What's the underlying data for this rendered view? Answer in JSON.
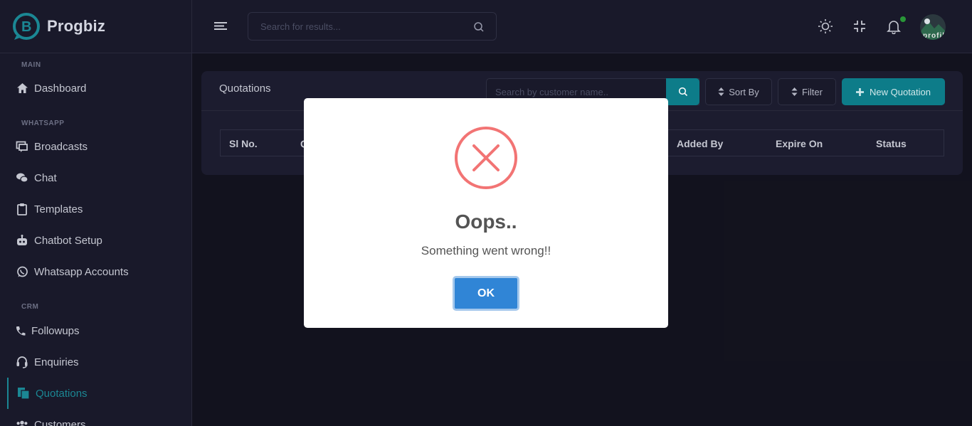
{
  "app": {
    "name": "Progbiz"
  },
  "sidebar": {
    "sections": [
      {
        "label": "MAIN"
      },
      {
        "label": "WHATSAPP"
      },
      {
        "label": "CRM"
      }
    ],
    "items": [
      {
        "label": "Dashboard",
        "icon": "home-icon"
      },
      {
        "label": "Broadcasts",
        "icon": "broadcast-icon"
      },
      {
        "label": "Chat",
        "icon": "chat-icon"
      },
      {
        "label": "Templates",
        "icon": "clipboard-icon"
      },
      {
        "label": "Chatbot Setup",
        "icon": "robot-icon"
      },
      {
        "label": "Whatsapp Accounts",
        "icon": "whatsapp-icon"
      },
      {
        "label": "Followups",
        "icon": "phone-icon"
      },
      {
        "label": "Enquiries",
        "icon": "headset-icon"
      },
      {
        "label": "Quotations",
        "icon": "documents-icon",
        "active": true
      },
      {
        "label": "Customers",
        "icon": "users-icon"
      }
    ]
  },
  "header": {
    "search_placeholder": "Search for results...",
    "avatar_alt": "profile"
  },
  "page": {
    "title": "Quotations",
    "customer_search_placeholder": "Search by customer name..",
    "sort_label": "Sort By",
    "filter_label": "Filter",
    "new_label": "New Quotation",
    "columns": [
      "Sl No.",
      "Q",
      "Added By",
      "Expire On",
      "Status"
    ]
  },
  "modal": {
    "title": "Oops..",
    "message": "Something went wrong!!",
    "button": "OK"
  },
  "colors": {
    "accent": "#0e7f8c",
    "error": "#f27474",
    "confirm": "#3085d6"
  }
}
